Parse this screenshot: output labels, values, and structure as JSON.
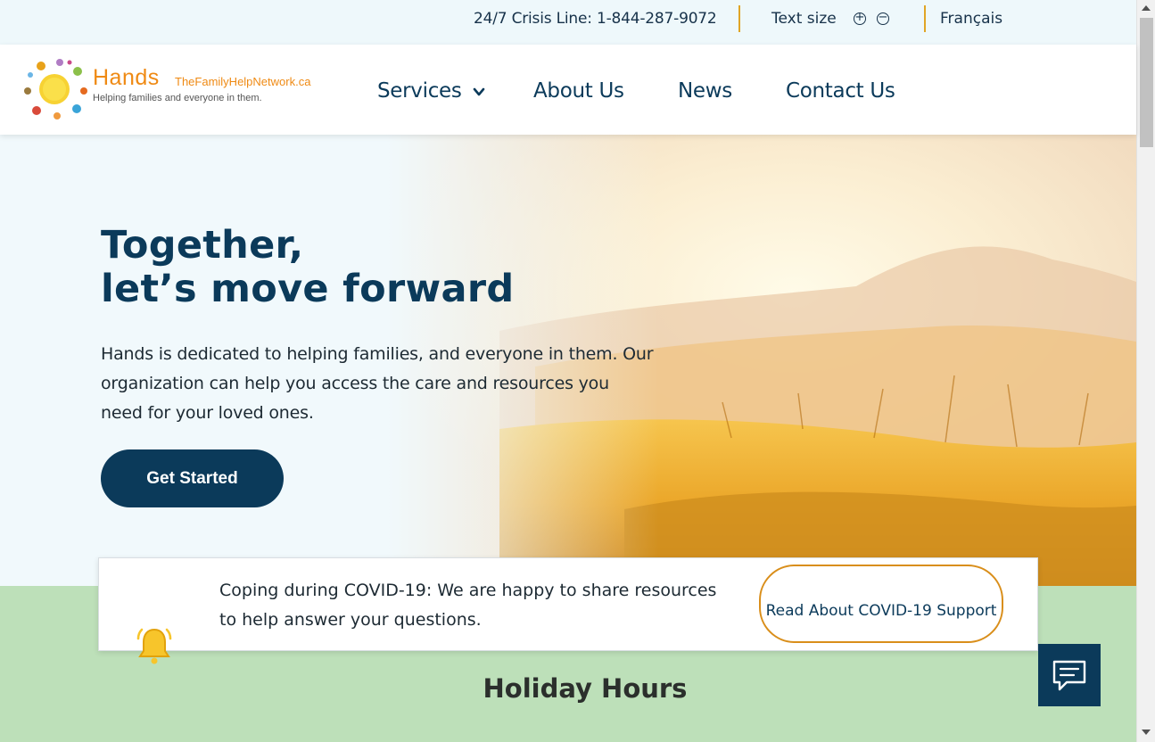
{
  "utility_bar": {
    "crisis_line": "24/7 Crisis Line: 1-844-287-9072",
    "text_size_label": "Text size",
    "increase_symbol": "+",
    "decrease_symbol": "−",
    "language_link": "Français"
  },
  "header": {
    "logo": {
      "word": "Hands",
      "domain": "TheFamilyHelpNetwork.ca",
      "tagline": "Helping families and everyone in them."
    },
    "nav": [
      "Services",
      "About Us",
      "News",
      "Contact Us"
    ]
  },
  "hero": {
    "title_line1": "Together,",
    "title_line2": "let’s move forward",
    "body": "Hands is dedicated to helping families, and everyone in them. Our organization can help you access the care and resources you need for your loved ones.",
    "cta": "Get Started"
  },
  "covid_banner": {
    "icon": "bell-icon",
    "text": "Coping during COVID-19: We are happy to share resources to help answer your questions.",
    "button": "Read About COVID-19 Support"
  },
  "section": {
    "heading": "Holiday Hours"
  },
  "chat": {
    "icon": "chat-icon"
  },
  "colors": {
    "primary": "#0b3a5a",
    "accent": "#e0a526",
    "utility_bg": "#eef8fb",
    "green_section": "#bde0b9",
    "logo_orange": "#ef8a14"
  }
}
